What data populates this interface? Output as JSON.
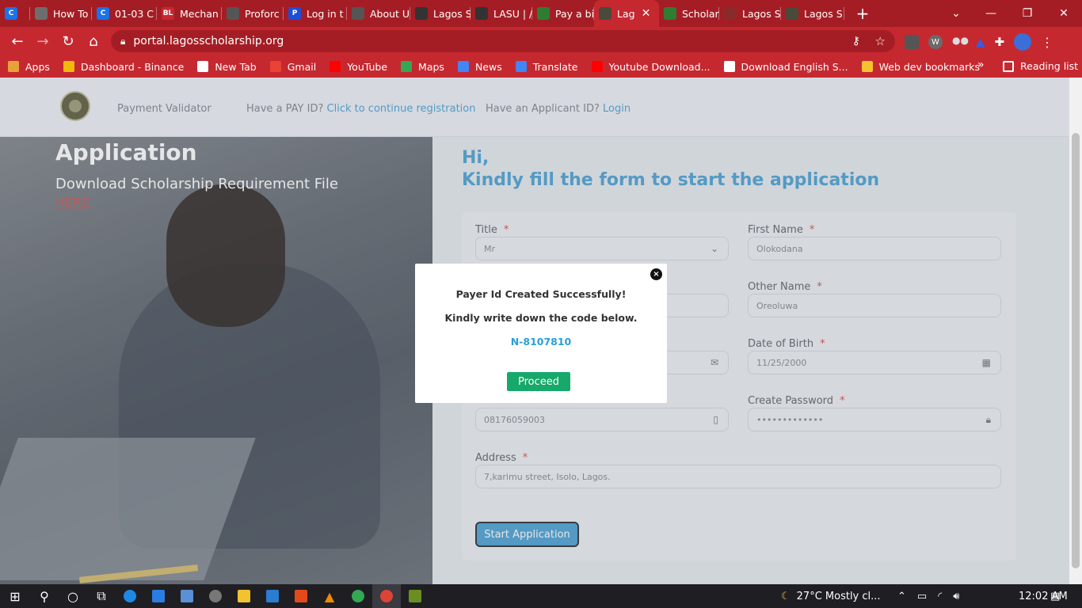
{
  "tabs": [
    {
      "title": "",
      "color": "#1a73e8",
      "glyph": "C"
    },
    {
      "title": "How To",
      "color": "#6d6d6d",
      "glyph": ""
    },
    {
      "title": "01-03 C",
      "color": "#1a73e8",
      "glyph": "C"
    },
    {
      "title": "Mechan",
      "color": "#c62830",
      "glyph": "BL"
    },
    {
      "title": "Proforc",
      "color": "#555555",
      "glyph": ""
    },
    {
      "title": "Log in t",
      "color": "#1d4ed8",
      "glyph": "P"
    },
    {
      "title": "About U",
      "color": "#555555",
      "glyph": ""
    },
    {
      "title": "Lagos S",
      "color": "#333333",
      "glyph": ""
    },
    {
      "title": "LASU | /",
      "color": "#333333",
      "glyph": ""
    },
    {
      "title": "Pay a bi",
      "color": "#2e7d32",
      "glyph": ""
    },
    {
      "title": "Lag",
      "color": "#4a4a3a",
      "glyph": ""
    },
    {
      "title": "Scholar",
      "color": "#2e7d32",
      "glyph": ""
    },
    {
      "title": "Lagos S",
      "color": "#8a2b2b",
      "glyph": ""
    },
    {
      "title": "Lagos S",
      "color": "#4a4a3a",
      "glyph": ""
    }
  ],
  "active_tab_index": 10,
  "address": {
    "url": "portal.lagosscholarship.org"
  },
  "bookmarks": [
    {
      "label": "Apps",
      "color": "#e8a13a"
    },
    {
      "label": "Dashboard - Binance",
      "color": "#f0b90b"
    },
    {
      "label": "New Tab",
      "color": "#ffffff"
    },
    {
      "label": "Gmail",
      "color": "#ea4335"
    },
    {
      "label": "YouTube",
      "color": "#ff0000"
    },
    {
      "label": "Maps",
      "color": "#34a853"
    },
    {
      "label": "News",
      "color": "#4285f4"
    },
    {
      "label": "Translate",
      "color": "#4285f4"
    },
    {
      "label": "Youtube Download...",
      "color": "#ff0000"
    },
    {
      "label": "Download English S...",
      "color": "#ffffff"
    },
    {
      "label": "Web dev bookmarks",
      "color": "#f4c430"
    }
  ],
  "bookmarks_more": "»",
  "reading_list": "Reading list",
  "site": {
    "nav": {
      "payment_validator": "Payment Validator",
      "pay_id_prompt": "Have a PAY ID?",
      "pay_id_link": "Click to continue registration",
      "applicant_prompt": "Have an Applicant ID?",
      "applicant_link": "Login"
    },
    "hero": {
      "title": "Application",
      "subtitle": "Download Scholarship Requirement File",
      "link": "HERE"
    },
    "greeting": {
      "line1": "Hi,",
      "line2": "Kindly fill the form to start the application"
    },
    "form": {
      "title_label": "Title",
      "title_value": "Mr",
      "first_name_label": "First Name",
      "first_name_value": "Olokodana",
      "other_name_label": "Other Name",
      "other_name_value": "Oreoluwa",
      "dob_label": "Date of Birth",
      "dob_value": "11/25/2000",
      "phone_value": "08176059003",
      "password_label": "Create Password",
      "password_value": "•••••••••••••",
      "address_label": "Address",
      "address_value": "7,karimu street, Isolo, Lagos.",
      "required_mark": "*",
      "start_button": "Start Application"
    }
  },
  "modal": {
    "line1": "Payer Id Created Successfully!",
    "line2": "Kindly write down the code below.",
    "code": "N-8107810",
    "proceed": "Proceed",
    "close": "×"
  },
  "taskbar": {
    "weather": "27°C  Mostly cl...",
    "time": "12:02 AM"
  }
}
